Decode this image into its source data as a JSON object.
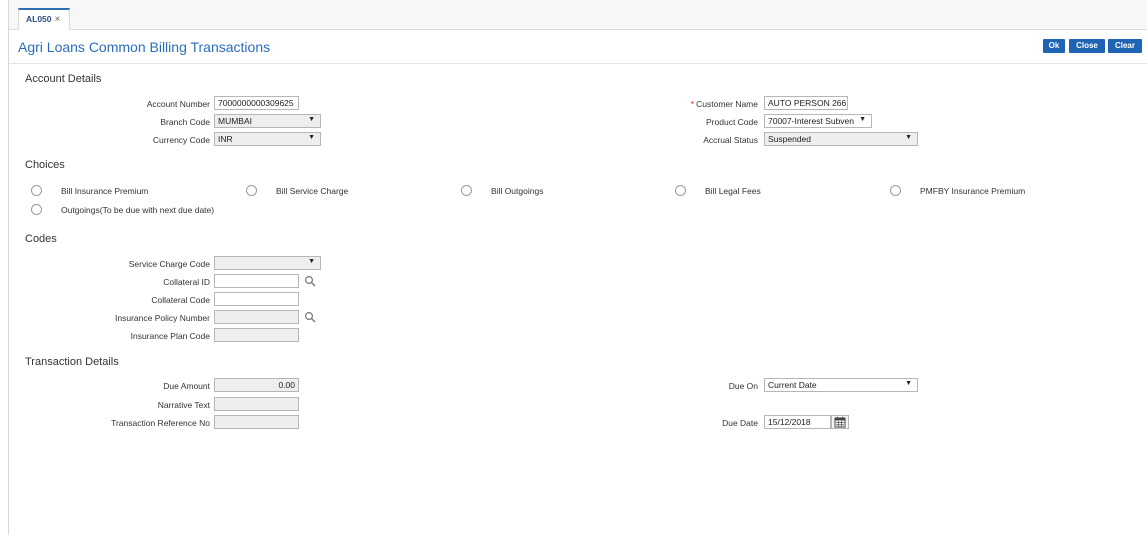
{
  "tab": {
    "label": "AL050",
    "close_glyph": "×"
  },
  "page": {
    "title": "Agri Loans Common Billing Transactions"
  },
  "buttons": {
    "ok": "Ok",
    "close": "Close",
    "clear": "Clear"
  },
  "account_details": {
    "heading": "Account Details",
    "account_number": {
      "label": "Account Number",
      "value": "7000000000309625"
    },
    "branch_code": {
      "label": "Branch Code",
      "value": "MUMBAI"
    },
    "currency_code": {
      "label": "Currency Code",
      "value": "INR"
    },
    "customer_name": {
      "label": "Customer Name",
      "value": "AUTO PERSON 266",
      "required_mark": "*"
    },
    "product_code": {
      "label": "Product Code",
      "value": "70007-Interest Subven"
    },
    "accrual_status": {
      "label": "Accrual Status",
      "value": "Suspended"
    }
  },
  "choices": {
    "heading": "Choices",
    "options": [
      "Bill Insurance Premium",
      "Bill Service Charge",
      "Bill Outgoings",
      "Bill Legal Fees",
      "PMFBY Insurance Premium",
      "Outgoings(To be due with next due date)"
    ]
  },
  "codes": {
    "heading": "Codes",
    "service_charge_code": {
      "label": "Service Charge Code",
      "value": ""
    },
    "collateral_id": {
      "label": "Collateral ID",
      "value": ""
    },
    "collateral_code": {
      "label": "Collateral Code",
      "value": ""
    },
    "insurance_policy_number": {
      "label": "Insurance Policy Number",
      "value": ""
    },
    "insurance_plan_code": {
      "label": "Insurance Plan Code",
      "value": ""
    }
  },
  "transaction_details": {
    "heading": "Transaction Details",
    "due_amount": {
      "label": "Due Amount",
      "value": "0.00"
    },
    "narrative_text": {
      "label": "Narrative Text",
      "value": ""
    },
    "transaction_reference_no": {
      "label": "Transaction Reference No",
      "value": ""
    },
    "due_on": {
      "label": "Due On",
      "value": "Current Date"
    },
    "due_date": {
      "label": "Due Date",
      "value": "15/12/2018"
    }
  },
  "colors": {
    "accent": "#1f63b3",
    "title": "#2a6ebb",
    "required": "#dd2222"
  },
  "icons": [
    "close-icon",
    "caret-down-icon",
    "search-icon",
    "calendar-icon"
  ]
}
